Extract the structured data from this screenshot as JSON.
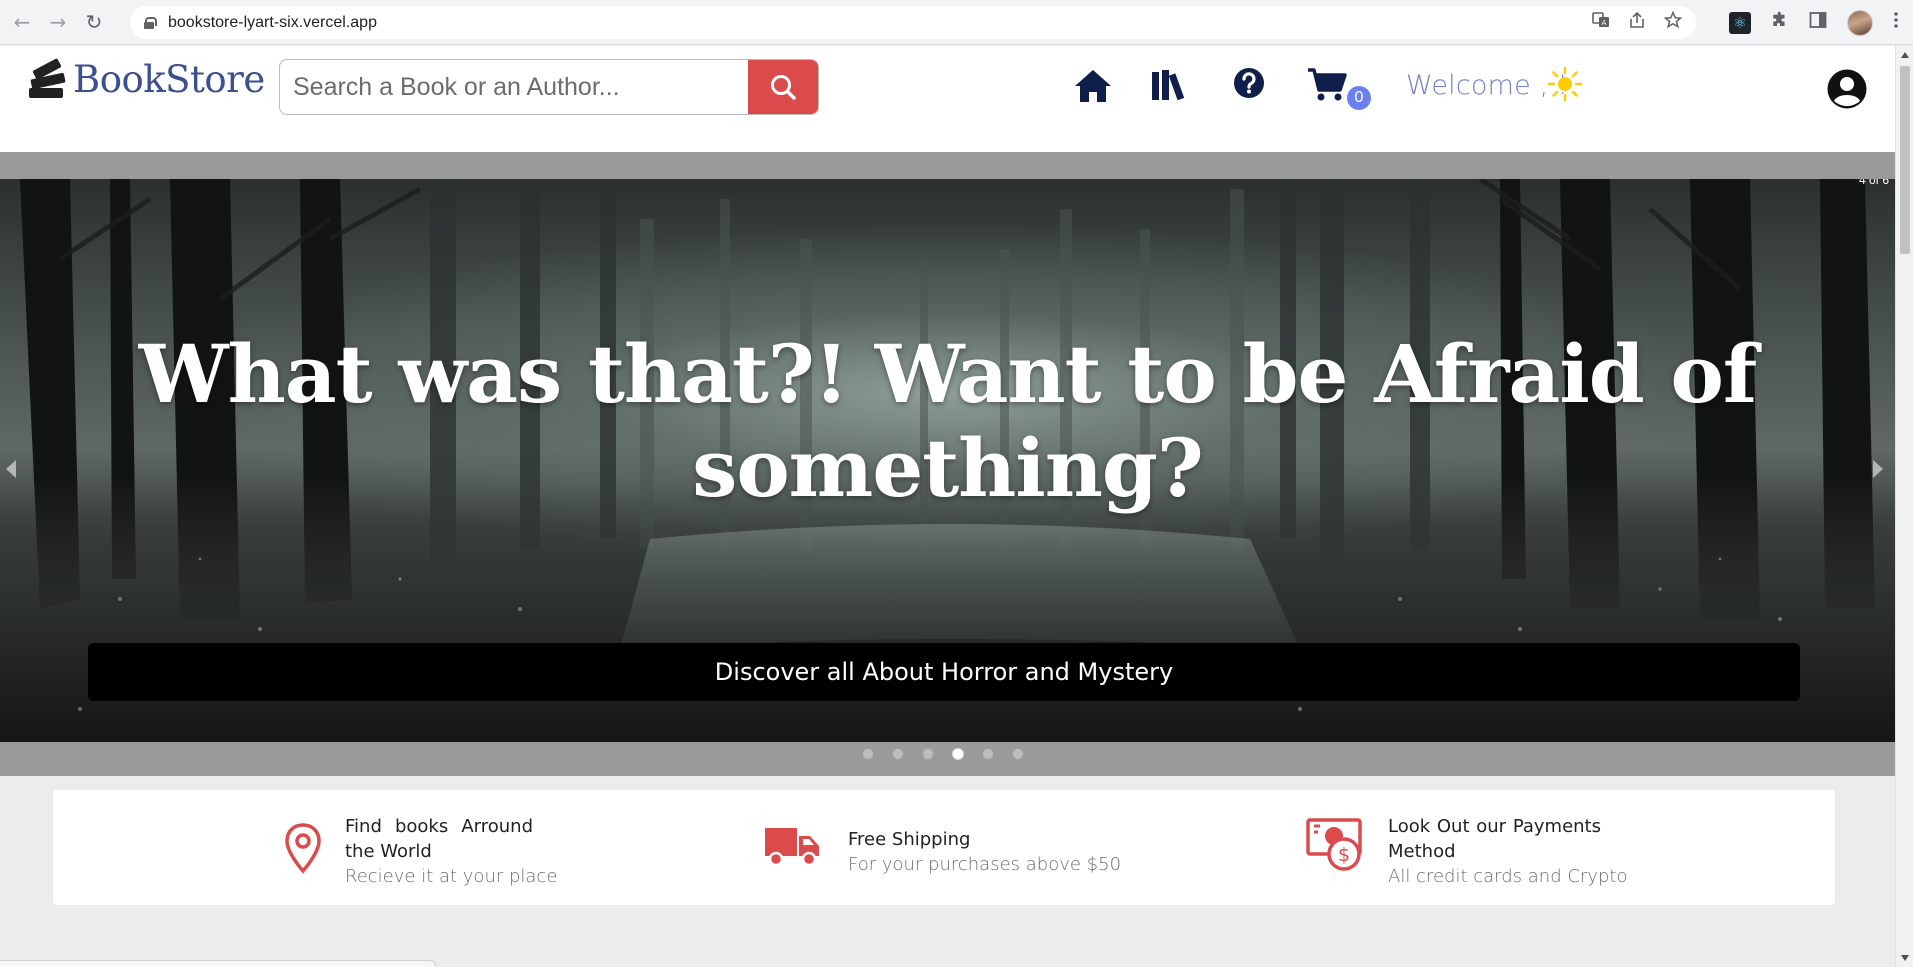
{
  "browser": {
    "url": "bookstore-lyart-six.vercel.app",
    "back_icon": "←",
    "forward_icon": "→",
    "reload_icon": "↻"
  },
  "header": {
    "logo_text": "BookStore",
    "search_placeholder": "Search a Book or an Author...",
    "cart_count": "0",
    "welcome_text": "Welcome , !",
    "colors": {
      "brand": "#3c4f8f",
      "accent": "#dc4b4b",
      "icon": "#0f1e4a",
      "badge": "#6c7ff0"
    }
  },
  "carousel": {
    "counter": "4 of 6",
    "title": "What was that?! Want to be Afraid of something?",
    "caption": "Discover all About Horror and Mystery",
    "total_slides": 6,
    "active_slide": 4
  },
  "features": [
    {
      "icon": "map-pin-icon",
      "title": "Find books Arround the World",
      "subtitle": "Recieve it at your place"
    },
    {
      "icon": "truck-icon",
      "title": "Free Shipping",
      "subtitle": "For your purchases above $50"
    },
    {
      "icon": "money-icon",
      "title": "Look Out our Payments Method",
      "subtitle": "All credit cards and Crypto"
    }
  ]
}
